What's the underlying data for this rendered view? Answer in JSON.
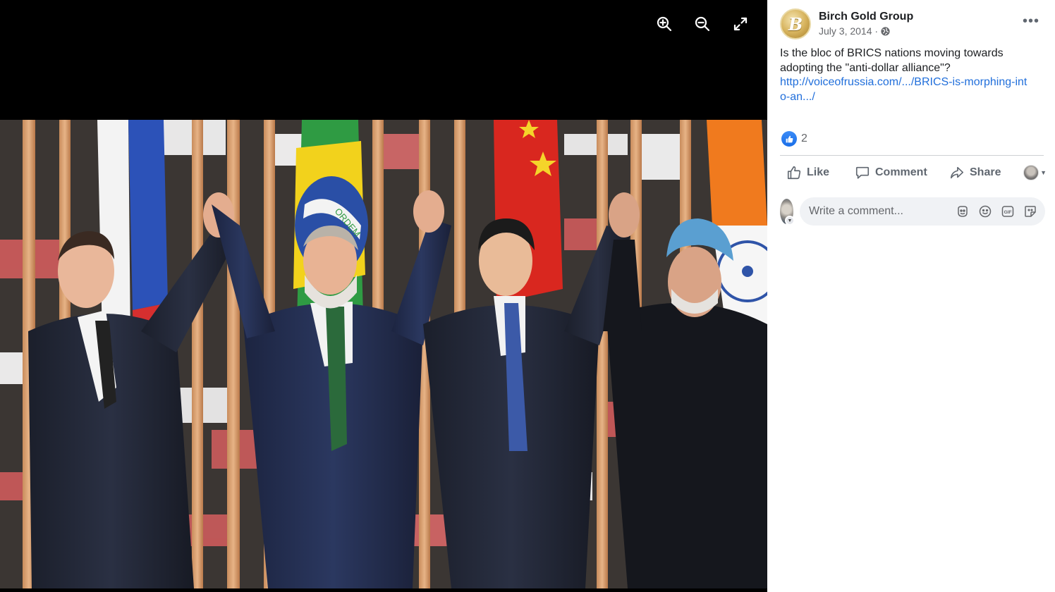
{
  "viewer": {
    "tools": [
      {
        "name": "zoom-in-icon"
      },
      {
        "name": "zoom-out-icon"
      },
      {
        "name": "fullscreen-icon"
      }
    ],
    "photo_flags": [
      "Russia",
      "Brazil",
      "China",
      "India"
    ],
    "flag_banner_text": "ORDEM"
  },
  "post": {
    "page_name": "Birch Gold Group",
    "avatar_letter": "B",
    "date": "July 3, 2014 ·",
    "more_label": "•••",
    "text": "Is the bloc of BRICS nations moving towards adopting the \"anti-dollar alliance\"?",
    "link_text": "http://voiceofrussia.com/.../BRICS-is-morphing-into-an.../",
    "reaction_count": "2",
    "actions": {
      "like": "Like",
      "comment": "Comment",
      "share": "Share"
    },
    "comment_placeholder": "Write a comment..."
  },
  "colors": {
    "link": "#216fdb",
    "like_blue": "#1a6ee8",
    "text": "#1c1e21",
    "muted": "#65676b"
  }
}
